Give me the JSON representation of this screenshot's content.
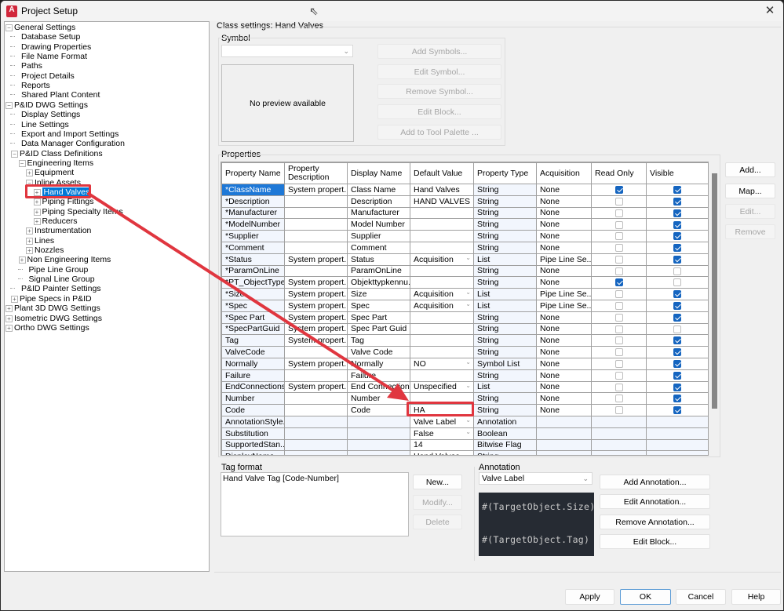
{
  "window": {
    "title": "Project Setup",
    "app_icon_letter": "A",
    "close_glyph": "✕"
  },
  "tree": {
    "items": [
      {
        "label": "General Settings",
        "level": 0,
        "expander": "−"
      },
      {
        "label": "Database Setup",
        "level": 1,
        "expander": ""
      },
      {
        "label": "Drawing Properties",
        "level": 1,
        "expander": ""
      },
      {
        "label": "File Name Format",
        "level": 1,
        "expander": ""
      },
      {
        "label": "Paths",
        "level": 1,
        "expander": ""
      },
      {
        "label": "Project Details",
        "level": 1,
        "expander": ""
      },
      {
        "label": "Reports",
        "level": 1,
        "expander": ""
      },
      {
        "label": "Shared Plant Content",
        "level": 1,
        "expander": ""
      },
      {
        "label": "P&ID DWG Settings",
        "level": 0,
        "expander": "−"
      },
      {
        "label": "Display Settings",
        "level": 1,
        "expander": ""
      },
      {
        "label": "Line Settings",
        "level": 1,
        "expander": ""
      },
      {
        "label": "Export and Import Settings",
        "level": 1,
        "expander": ""
      },
      {
        "label": "Data Manager Configuration",
        "level": 1,
        "expander": ""
      },
      {
        "label": "P&ID Class Definitions",
        "level": 1,
        "expander": "−"
      },
      {
        "label": "Engineering Items",
        "level": 2,
        "expander": "−"
      },
      {
        "label": "Equipment",
        "level": 3,
        "expander": "+"
      },
      {
        "label": "Inline Assets",
        "level": 3,
        "expander": "−"
      },
      {
        "label": "Hand Valves",
        "level": 4,
        "expander": "+",
        "selected": true
      },
      {
        "label": "Piping Fittings",
        "level": 4,
        "expander": "+"
      },
      {
        "label": "Piping Specialty Items",
        "level": 4,
        "expander": "+"
      },
      {
        "label": "Reducers",
        "level": 4,
        "expander": "+"
      },
      {
        "label": "Instrumentation",
        "level": 3,
        "expander": "+"
      },
      {
        "label": "Lines",
        "level": 3,
        "expander": "+"
      },
      {
        "label": "Nozzles",
        "level": 3,
        "expander": "+"
      },
      {
        "label": "Non Engineering Items",
        "level": 2,
        "expander": "+"
      },
      {
        "label": "Pipe Line Group",
        "level": 2,
        "expander": ""
      },
      {
        "label": "Signal Line Group",
        "level": 2,
        "expander": ""
      },
      {
        "label": "P&ID Painter Settings",
        "level": 1,
        "expander": ""
      },
      {
        "label": "Pipe Specs in P&ID",
        "level": 1,
        "expander": "+"
      },
      {
        "label": "Plant 3D DWG Settings",
        "level": 0,
        "expander": "+"
      },
      {
        "label": "Isometric DWG Settings",
        "level": 0,
        "expander": "+"
      },
      {
        "label": "Ortho DWG Settings",
        "level": 0,
        "expander": "+"
      }
    ]
  },
  "class_settings": {
    "heading": "Class settings: Hand Valves",
    "symbol": {
      "label": "Symbol",
      "combo_value": "",
      "preview_text": "No preview available",
      "buttons": [
        {
          "label": "Add Symbols...",
          "enabled": false
        },
        {
          "label": "Edit Symbol...",
          "enabled": false
        },
        {
          "label": "Remove Symbol...",
          "enabled": false
        },
        {
          "label": "Edit Block...",
          "enabled": false
        },
        {
          "label": "Add to Tool Palette ...",
          "enabled": false
        }
      ]
    },
    "properties": {
      "label": "Properties",
      "columns": [
        "Property Name",
        "Property Description",
        "Display Name",
        "Default Value",
        "Property Type",
        "Acquisition",
        "Read Only",
        "Visible"
      ],
      "rows": [
        {
          "name": "*ClassName",
          "desc": "System propert...",
          "display": "Class Name",
          "default": "Hand Valves",
          "dd": false,
          "type": "String",
          "acq": "None",
          "ro": true,
          "vis": true,
          "selected": true
        },
        {
          "name": "*Description",
          "desc": "",
          "display": "Description",
          "default": "HAND VALVES",
          "dd": false,
          "type": "String",
          "acq": "None",
          "ro": false,
          "vis": true
        },
        {
          "name": "*Manufacturer",
          "desc": "",
          "display": "Manufacturer",
          "default": "",
          "dd": false,
          "type": "String",
          "acq": "None",
          "ro": false,
          "vis": true
        },
        {
          "name": "*ModelNumber",
          "desc": "",
          "display": "Model Number",
          "default": "",
          "dd": false,
          "type": "String",
          "acq": "None",
          "ro": false,
          "vis": true
        },
        {
          "name": "*Supplier",
          "desc": "",
          "display": "Supplier",
          "default": "",
          "dd": false,
          "type": "String",
          "acq": "None",
          "ro": false,
          "vis": true
        },
        {
          "name": "*Comment",
          "desc": "",
          "display": "Comment",
          "default": "",
          "dd": false,
          "type": "String",
          "acq": "None",
          "ro": false,
          "vis": true
        },
        {
          "name": "*Status",
          "desc": "System propert...",
          "display": "Status",
          "default": "Acquisition",
          "dd": true,
          "type": "List",
          "acq": "Pipe Line Se...",
          "ro": false,
          "vis": true
        },
        {
          "name": "*ParamOnLine",
          "desc": "",
          "display": "ParamOnLine",
          "default": "",
          "dd": false,
          "type": "String",
          "acq": "None",
          "ro": false,
          "vis": false
        },
        {
          "name": "*PT_ObjectType",
          "desc": "System propert...",
          "display": "Objekttypkennu...",
          "default": "",
          "dd": false,
          "type": "String",
          "acq": "None",
          "ro": true,
          "vis": false
        },
        {
          "name": "*Size",
          "desc": "System propert...",
          "display": "Size",
          "default": "Acquisition",
          "dd": true,
          "type": "List",
          "acq": "Pipe Line Se...",
          "ro": false,
          "vis": true
        },
        {
          "name": "*Spec",
          "desc": "System propert...",
          "display": "Spec",
          "default": "Acquisition",
          "dd": true,
          "type": "List",
          "acq": "Pipe Line Se...",
          "ro": false,
          "vis": true
        },
        {
          "name": "*Spec Part",
          "desc": "System propert...",
          "display": "Spec Part",
          "default": "",
          "dd": false,
          "type": "String",
          "acq": "None",
          "ro": false,
          "vis": true
        },
        {
          "name": "*SpecPartGuid",
          "desc": "System propert...",
          "display": "Spec Part Guid",
          "default": "",
          "dd": false,
          "type": "String",
          "acq": "None",
          "ro": false,
          "vis": false
        },
        {
          "name": "Tag",
          "desc": "System propert...",
          "display": "Tag",
          "default": "",
          "dd": false,
          "type": "String",
          "acq": "None",
          "ro": false,
          "vis": true
        },
        {
          "name": "ValveCode",
          "desc": "",
          "display": "Valve Code",
          "default": "",
          "dd": false,
          "type": "String",
          "acq": "None",
          "ro": false,
          "vis": true
        },
        {
          "name": "Normally",
          "desc": "System propert...",
          "display": "Normally",
          "default": "NO",
          "dd": true,
          "type": "Symbol List",
          "acq": "None",
          "ro": false,
          "vis": true
        },
        {
          "name": "Failure",
          "desc": "",
          "display": "Failure",
          "default": "",
          "dd": false,
          "type": "String",
          "acq": "None",
          "ro": false,
          "vis": true
        },
        {
          "name": "EndConnections",
          "desc": "System propert...",
          "display": "End Connections",
          "default": "Unspecified",
          "dd": true,
          "type": "List",
          "acq": "None",
          "ro": false,
          "vis": true
        },
        {
          "name": "Number",
          "desc": "",
          "display": "Number",
          "default": "",
          "dd": false,
          "type": "String",
          "acq": "None",
          "ro": false,
          "vis": true
        },
        {
          "name": "Code",
          "desc": "",
          "display": "Code",
          "default": "HA",
          "dd": false,
          "type": "String",
          "acq": "None",
          "ro": false,
          "vis": true
        },
        {
          "name": "AnnotationStyle...",
          "desc": "",
          "display": "",
          "default": "Valve Label",
          "dd": true,
          "type": "Annotation",
          "acq": "",
          "ro": null,
          "vis": null
        },
        {
          "name": "Substitution",
          "desc": "",
          "display": "",
          "default": "False",
          "dd": true,
          "type": "Boolean",
          "acq": "",
          "ro": null,
          "vis": null
        },
        {
          "name": "SupportedStan...",
          "desc": "",
          "display": "",
          "default": "14",
          "dd": false,
          "type": "Bitwise Flag",
          "acq": "",
          "ro": null,
          "vis": null
        },
        {
          "name": "DisplayName",
          "desc": "",
          "display": "",
          "default": "Hand Valves",
          "dd": false,
          "type": "String",
          "acq": "",
          "ro": null,
          "vis": null
        }
      ],
      "side_buttons": [
        {
          "label": "Add...",
          "enabled": true
        },
        {
          "label": "Map...",
          "enabled": true
        },
        {
          "label": "Edit...",
          "enabled": false
        },
        {
          "label": "Remove",
          "enabled": false
        }
      ]
    },
    "tag_format": {
      "label": "Tag format",
      "items": [
        "Hand Valve Tag [Code-Number]"
      ],
      "buttons": [
        {
          "label": "New...",
          "enabled": true
        },
        {
          "label": "Modify...",
          "enabled": false
        },
        {
          "label": "Delete",
          "enabled": false
        }
      ]
    },
    "annotation": {
      "label": "Annotation",
      "combo_value": "Valve Label",
      "preview_lines": [
        "#(TargetObject.Size)",
        "#(TargetObject.Tag)"
      ],
      "buttons": [
        {
          "label": "Add Annotation...",
          "enabled": true
        },
        {
          "label": "Edit Annotation...",
          "enabled": true
        },
        {
          "label": "Remove Annotation...",
          "enabled": true
        },
        {
          "label": "Edit Block...",
          "enabled": true
        }
      ]
    }
  },
  "footer": {
    "buttons": [
      "Apply",
      "OK",
      "Cancel",
      "Help"
    ]
  },
  "annotation_overlay": {
    "color": "#e0363f",
    "from": "Hand Valves tree item",
    "to": "Code default value HA"
  }
}
